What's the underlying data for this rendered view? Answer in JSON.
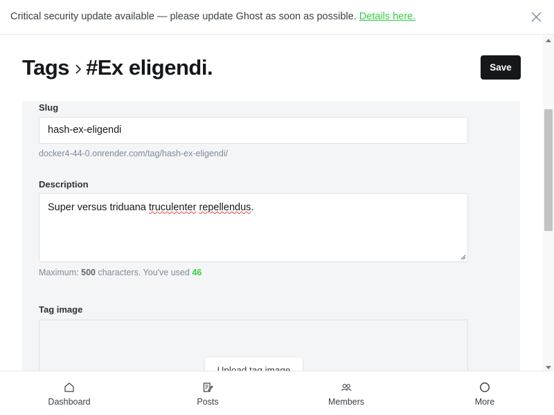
{
  "banner": {
    "message": "Critical security update available — please update Ghost as soon as possible.",
    "link_text": "Details here."
  },
  "header": {
    "breadcrumb_root": "Tags",
    "breadcrumb_current": "#Ex eligendi.",
    "save_label": "Save"
  },
  "form": {
    "slug": {
      "label": "Slug",
      "value": "hash-ex-eligendi",
      "url_hint": "docker4-44-0.onrender.com/tag/hash-ex-eligendi/"
    },
    "description": {
      "label": "Description",
      "value_prefix": "Super versus triduana ",
      "misspelled_1": "truculenter",
      "value_middle": " ",
      "misspelled_2": "repellendus",
      "value_suffix": ".",
      "counter_prefix": "Maximum:",
      "max_chars": "500",
      "counter_middle": "characters. You've used",
      "used_chars": "46"
    },
    "tag_image": {
      "label": "Tag image",
      "upload_label": "Upload tag image"
    }
  },
  "bottom_nav": {
    "items": [
      {
        "label": "Dashboard",
        "icon": "house-icon"
      },
      {
        "label": "Posts",
        "icon": "posts-icon"
      },
      {
        "label": "Members",
        "icon": "members-icon"
      },
      {
        "label": "More",
        "icon": "more-icon"
      }
    ]
  },
  "colors": {
    "accent_green": "#30cf43",
    "primary_button": "#15171a",
    "panel_background": "#f4f5f6"
  }
}
